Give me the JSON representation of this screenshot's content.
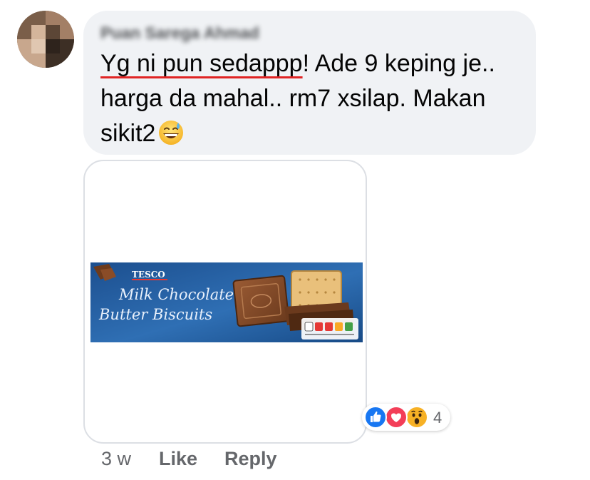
{
  "comment": {
    "author": "Puan Sarega Ahmad",
    "text_underlined": "Yg ni pun sedappp",
    "text_rest": "! Ade 9 keping je.. harga da mahal.. rm7 xsilap. Makan sikit2",
    "emoji": "grinning-face-with-sweat-icon"
  },
  "attachment": {
    "brand": "TESCO",
    "product_line1": "Milk Chocolate",
    "product_line2": "Butter Biscuits"
  },
  "reactions": {
    "types": [
      "like-icon",
      "love-icon",
      "wow-icon"
    ],
    "count": "4"
  },
  "actions": {
    "time": "3 w",
    "like_label": "Like",
    "reply_label": "Reply"
  },
  "colors": {
    "bubble": "#f0f2f5",
    "like": "#1877f2",
    "love": "#f33e58",
    "wow": "#f7b125",
    "secondary_text": "#65676b",
    "spell_underline": "#e02424"
  }
}
